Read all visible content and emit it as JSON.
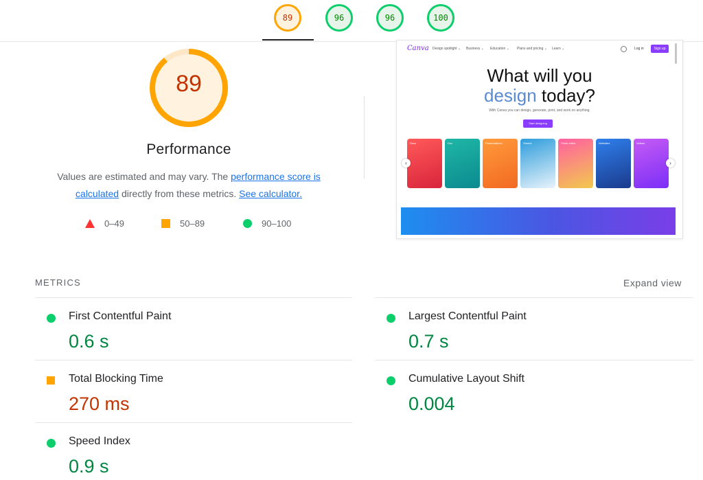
{
  "tabs": [
    {
      "score": "89",
      "status": "average",
      "color": "#ffa400"
    },
    {
      "score": "96",
      "status": "pass",
      "color": "#0cce6b"
    },
    {
      "score": "96",
      "status": "pass",
      "color": "#0cce6b"
    },
    {
      "score": "100",
      "status": "pass",
      "color": "#0cce6b"
    }
  ],
  "gauge": {
    "score": "89",
    "score_fraction": 0.89,
    "title": "Performance"
  },
  "description": {
    "prefix": "Values are estimated and may vary. The ",
    "link1": "performance score is calculated",
    "middle": " directly from these metrics. ",
    "link2": "See calculator."
  },
  "legend": [
    {
      "range": "0–49",
      "icon": "triangle-fail-icon",
      "color": "#ff3333"
    },
    {
      "range": "50–89",
      "icon": "square-average-icon",
      "color": "#ffa400"
    },
    {
      "range": "90–100",
      "icon": "circle-pass-icon",
      "color": "#0cce6b"
    }
  ],
  "screenshot": {
    "brand": "Canva",
    "nav": [
      "Design spotlight ⌄",
      "Business ⌄",
      "Education ⌄",
      "Plans and pricing ⌄",
      "Learn ⌄"
    ],
    "login": "Log in",
    "signup": "Sign up",
    "hero_line1": "What will you",
    "hero_accent": "design",
    "hero_line2_rest": " today?",
    "hero_sub": "With Canva you can design, generate, print, and work on anything.",
    "hero_button": "Start designing",
    "cards": [
      "Docs",
      "Doc",
      "Presentations",
      "Sheets",
      "Photo editor",
      "Websites",
      "Videos"
    ]
  },
  "metrics": {
    "title": "METRICS",
    "expand": "Expand view",
    "items": [
      {
        "name": "First Contentful Paint",
        "value": "0.6 s",
        "status": "pass"
      },
      {
        "name": "Largest Contentful Paint",
        "value": "0.7 s",
        "status": "pass"
      },
      {
        "name": "Total Blocking Time",
        "value": "270 ms",
        "status": "average"
      },
      {
        "name": "Cumulative Layout Shift",
        "value": "0.004",
        "status": "pass"
      },
      {
        "name": "Speed Index",
        "value": "0.9 s",
        "status": "pass"
      }
    ]
  }
}
